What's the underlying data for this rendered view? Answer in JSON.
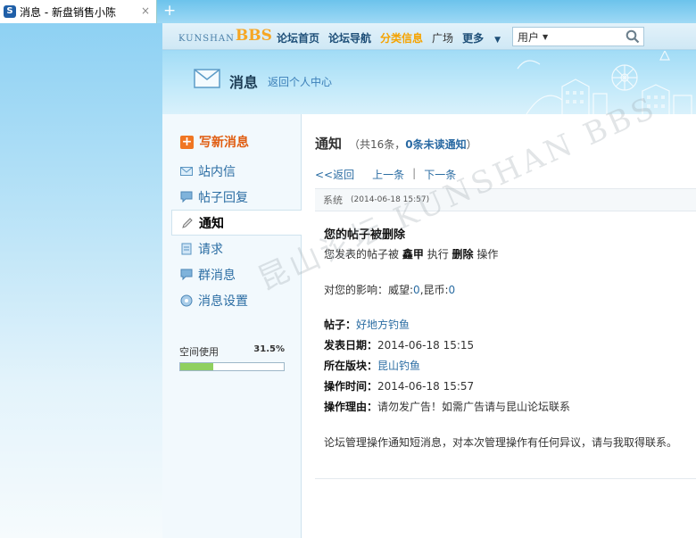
{
  "browser": {
    "tab_title": "消息 - 新盘销售小陈",
    "tab_close": "×",
    "new_tab": "+",
    "tab_icon": "S"
  },
  "site": {
    "logo_prefix": "KUNSHAN",
    "logo_bbs": "BBS",
    "nav": [
      "论坛首页",
      "论坛导航",
      "分类信息",
      "广场",
      "更多"
    ],
    "nav_active_index": 2,
    "search_scope": "用户",
    "accent_color": "#f5a300",
    "link_color": "#2b6da3"
  },
  "banner": {
    "title": "消息",
    "back_link": "返回个人中心"
  },
  "sidebar": {
    "compose": "写新消息",
    "items": [
      {
        "label": "站内信",
        "icon": "envelope-icon"
      },
      {
        "label": "帖子回复",
        "icon": "speech-bubble-icon"
      },
      {
        "label": "通知",
        "icon": "pencil-icon"
      },
      {
        "label": "请求",
        "icon": "document-icon"
      },
      {
        "label": "群消息",
        "icon": "speech-bubble-icon"
      },
      {
        "label": "消息设置",
        "icon": "circle-settings-icon"
      }
    ],
    "active_index": 2,
    "space_label": "空间使用",
    "space_pct": "31.5%",
    "space_fraction": 0.315
  },
  "main": {
    "title": "通知",
    "count_prefix": "（共16条，",
    "unread": "0条未读通知",
    "count_suffix": "）",
    "back": "<<返回",
    "prev": "上一条",
    "sep": "|",
    "next": "下一条",
    "meta_from": "系统",
    "meta_date": "(2014-06-18 15:57)",
    "subject": "您的帖子被删除",
    "line1_a": "您发表的帖子被",
    "line1_actor": "鑫甲",
    "line1_b": "执行",
    "line1_action": "删除",
    "line1_c": "操作",
    "impact_a": "对您的影响：威望:",
    "impact_v1": "0",
    "impact_b": ",昆币:",
    "impact_v2": "0",
    "fields": [
      {
        "k": "帖子：",
        "v": "好地方钓鱼",
        "link": true
      },
      {
        "k": "发表日期：",
        "v": "2014-06-18 15:15",
        "link": false
      },
      {
        "k": "所在版块：",
        "v": "昆山钓鱼",
        "link": true
      },
      {
        "k": "操作时间：",
        "v": "2014-06-18 15:57",
        "link": false
      },
      {
        "k": "操作理由：",
        "v": "请勿发广告！如需广告请与昆山论坛联系",
        "link": false
      }
    ],
    "footer": "论坛管理操作通知短消息，对本次管理操作有任何异议，请与我取得联系。",
    "watermark": "昆山论坛 KUNSHAN BBS"
  }
}
